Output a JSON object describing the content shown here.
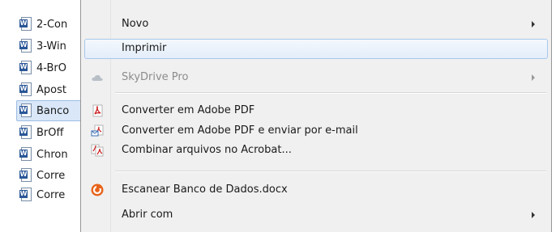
{
  "files": [
    {
      "name": "2-Con",
      "selected": false
    },
    {
      "name": "3-Win",
      "selected": false
    },
    {
      "name": "4-BrO",
      "selected": false
    },
    {
      "name": "Apost",
      "selected": false
    },
    {
      "name": "Banco",
      "selected": true
    },
    {
      "name": "BrOff",
      "selected": false
    },
    {
      "name": "Chron",
      "selected": false
    },
    {
      "name": "Corre",
      "selected": false
    },
    {
      "name": "Corre",
      "selected": false
    }
  ],
  "word_badge": "W",
  "menu": {
    "new": "Novo",
    "print": "Imprimir",
    "skydrive": "SkyDrive Pro",
    "convert_pdf": "Converter em Adobe PDF",
    "convert_pdf_email": "Converter em Adobe PDF e enviar por e-mail",
    "combine_acrobat": "Combinar arquivos no Acrobat...",
    "scan": "Escanear Banco de Dados.docx",
    "open_with": "Abrir com"
  },
  "icons": {
    "skydrive": "cloud-icon",
    "convert_pdf": "pdf-icon",
    "convert_pdf_email": "pdf-email-icon",
    "combine_acrobat": "acrobat-combine-icon",
    "scan": "antivirus-scan-icon"
  },
  "colors": {
    "menu_bg": "#f0f0f0",
    "highlight_border": "#a8c8ec",
    "pdf_red": "#cc1d1d",
    "scan_orange": "#e8641b"
  }
}
